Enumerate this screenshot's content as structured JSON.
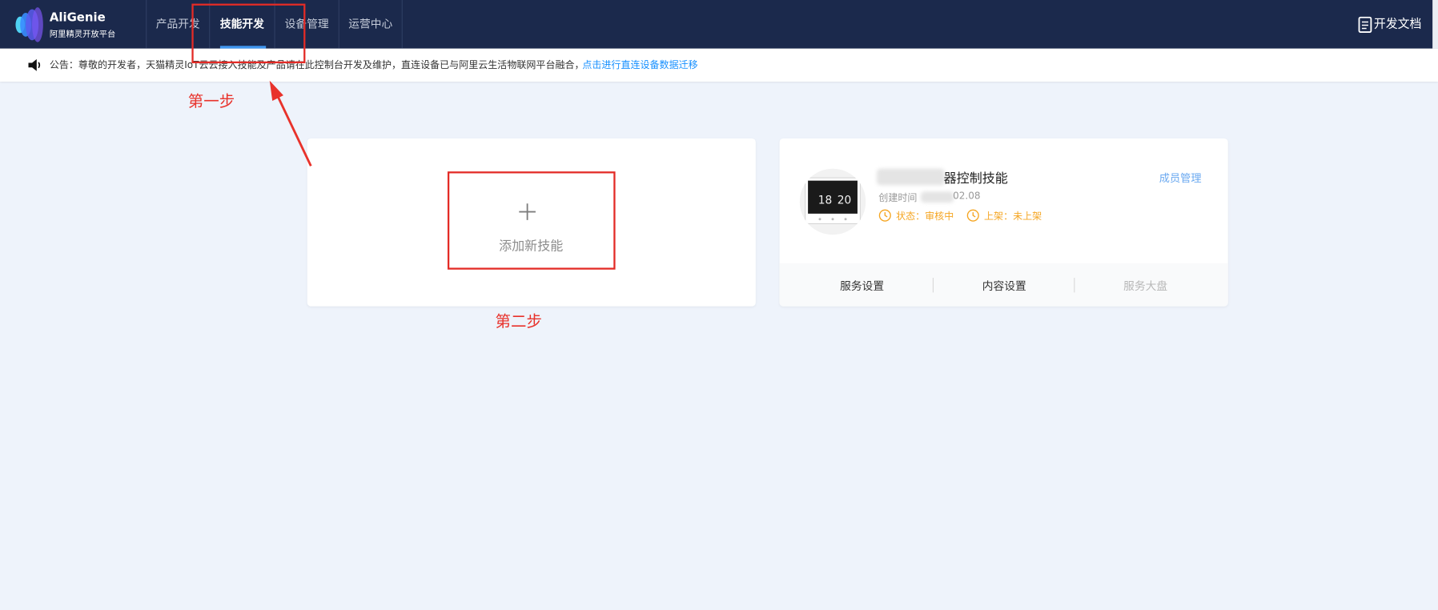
{
  "brand": {
    "name": "AliGenie",
    "subtitle": "阿里精灵开放平台"
  },
  "nav": {
    "items": [
      {
        "label": "产品开发"
      },
      {
        "label": "技能开发",
        "active": true
      },
      {
        "label": "设备管理"
      },
      {
        "label": "运营中心"
      }
    ],
    "docs_label": "开发文档",
    "docs_icon": "document-icon"
  },
  "notice": {
    "icon": "speaker-icon",
    "text": "公告：尊敬的开发者，天猫精灵IoT云云接入技能及产品请在此控制台开发及维护，直连设备已与阿里云生活物联网平台融合，",
    "link": "点击进行直连设备数据迁移"
  },
  "add_skill": {
    "label": "添加新技能",
    "icon": "plus-icon"
  },
  "skill": {
    "name": "器控制技能",
    "created_label": "创建时间",
    "created_value": "02.08",
    "status_label": "状态：审核中",
    "shelf_label": "上架：未上架",
    "status_icon": "clock-icon",
    "member_link": "成员管理",
    "thumbnail_readings": {
      "left": "18",
      "right": "20"
    },
    "actions": [
      {
        "label": "服务设置",
        "enabled": true
      },
      {
        "label": "内容设置",
        "enabled": true
      },
      {
        "label": "服务大盘",
        "enabled": false
      }
    ]
  },
  "annotations": {
    "step1": "第一步",
    "step2": "第二步",
    "color": "#e8322b"
  },
  "colors": {
    "topbar": "#1b294c",
    "accent": "#3f95ee",
    "link": "#1890ff",
    "status": "#f5a623",
    "page_bg": "#eef3fb"
  }
}
